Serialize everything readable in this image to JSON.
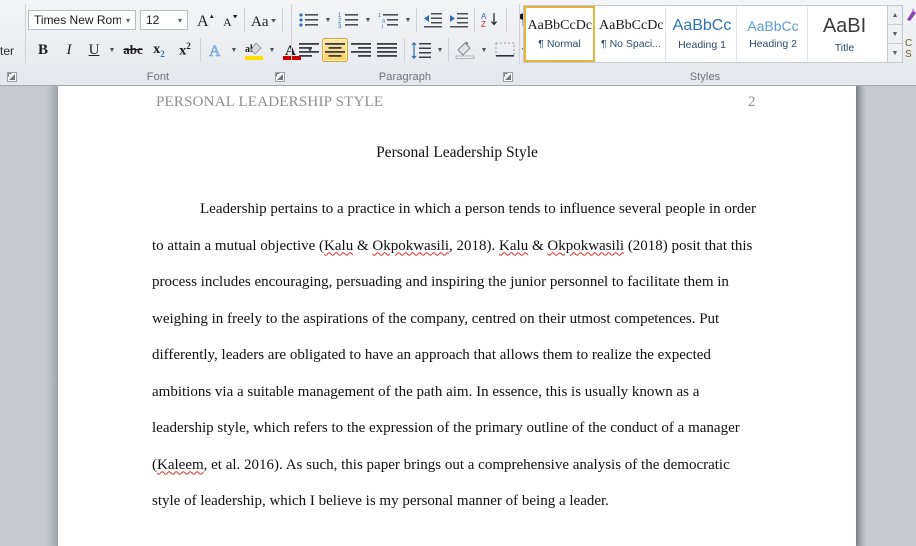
{
  "ribbon": {
    "clipboard": {
      "truncated_label": "ter"
    },
    "font_group": {
      "label": "Font",
      "font_name": "Times New Rom",
      "font_size": "12",
      "buttons": [
        {
          "name": "grow-font-icon",
          "glyph": "A"
        },
        {
          "name": "shrink-font-icon",
          "glyph": "A"
        },
        {
          "name": "change-case-icon",
          "glyph": "Aa"
        },
        {
          "name": "clear-formatting-icon",
          "glyph": "A"
        },
        {
          "name": "bold-icon",
          "glyph": "B"
        },
        {
          "name": "italic-icon",
          "glyph": "I"
        },
        {
          "name": "underline-icon",
          "glyph": "U"
        },
        {
          "name": "strikethrough-icon",
          "glyph": "abc"
        },
        {
          "name": "subscript-icon",
          "glyph": "x"
        },
        {
          "name": "superscript-icon",
          "glyph": "x"
        },
        {
          "name": "text-effects-icon",
          "glyph": "A"
        },
        {
          "name": "text-highlight-color-icon",
          "glyph": "ab"
        },
        {
          "name": "font-color-icon",
          "glyph": "A"
        }
      ]
    },
    "paragraph_group": {
      "label": "Paragraph",
      "buttons": [
        {
          "name": "bullets-icon"
        },
        {
          "name": "numbering-icon"
        },
        {
          "name": "multilevel-list-icon"
        },
        {
          "name": "decrease-indent-icon"
        },
        {
          "name": "increase-indent-icon"
        },
        {
          "name": "sort-icon"
        },
        {
          "name": "show-formatting-marks-icon"
        },
        {
          "name": "align-left-icon"
        },
        {
          "name": "align-center-icon"
        },
        {
          "name": "align-right-icon"
        },
        {
          "name": "justify-icon"
        },
        {
          "name": "line-spacing-icon"
        },
        {
          "name": "shading-icon"
        },
        {
          "name": "borders-icon"
        }
      ],
      "active_alignment": "align-center-icon"
    },
    "styles_group": {
      "label": "Styles",
      "selected": "Normal",
      "items": [
        {
          "preview": "AaBbCcDc",
          "name": "¶ Normal",
          "kind": "normal",
          "selected": true
        },
        {
          "preview": "AaBbCcDc",
          "name": "¶ No Spaci...",
          "kind": "normal",
          "selected": false
        },
        {
          "preview": "AaBbCc",
          "name": "Heading 1",
          "kind": "h1",
          "selected": false
        },
        {
          "preview": "AaBbCc",
          "name": "Heading 2",
          "kind": "h2",
          "selected": false
        },
        {
          "preview": "AaBI",
          "name": "Title",
          "kind": "ti",
          "selected": false
        }
      ],
      "scroll_buttons": [
        "▲",
        "▼",
        "▼"
      ],
      "change_styles_remnant": "C\nS"
    },
    "accent_colors": {
      "active_button_bg": "#fbd165",
      "active_button_border": "#e0a12c",
      "style_name_text": "#2b4a6f",
      "heading1": "#2e74b5",
      "heading2": "#5b9bd5",
      "group_label": "#6d7480"
    }
  },
  "document": {
    "header_text": "PERSONAL LEADERSHIP STYLE",
    "page_number": "2",
    "title": "Personal Leadership Style",
    "paragraph_runs": [
      {
        "text": "Leadership pertains to a practice in which a person tends to influence several people in order to attain a mutual objective (",
        "misspelled": false
      },
      {
        "text": "Kalu",
        "misspelled": true
      },
      {
        "text": " & ",
        "misspelled": false
      },
      {
        "text": "Okpokwasili",
        "misspelled": true
      },
      {
        "text": ", 2018). ",
        "misspelled": false
      },
      {
        "text": "Kalu",
        "misspelled": true
      },
      {
        "text": " & ",
        "misspelled": false
      },
      {
        "text": "Okpokwasili",
        "misspelled": true
      },
      {
        "text": " (2018) posit that this process includes encouraging, persuading and inspiring the junior personnel to facilitate them in weighing in freely to the aspirations of the company, centred on their utmost competences. Put differently, leaders are obligated to have an approach that allows them to realize the expected ambitions via a suitable management of the path aim. In essence, this is usually known as a leadership style, which refers to the expression of the primary outline of the conduct of a manager (",
        "misspelled": false
      },
      {
        "text": "Kaleem",
        "misspelled": true
      },
      {
        "text": ", et al. 2016). As such, this paper brings out a comprehensive analysis of the democratic style of leadership, which I believe is my personal manner of being a leader.",
        "misspelled": false
      }
    ]
  }
}
